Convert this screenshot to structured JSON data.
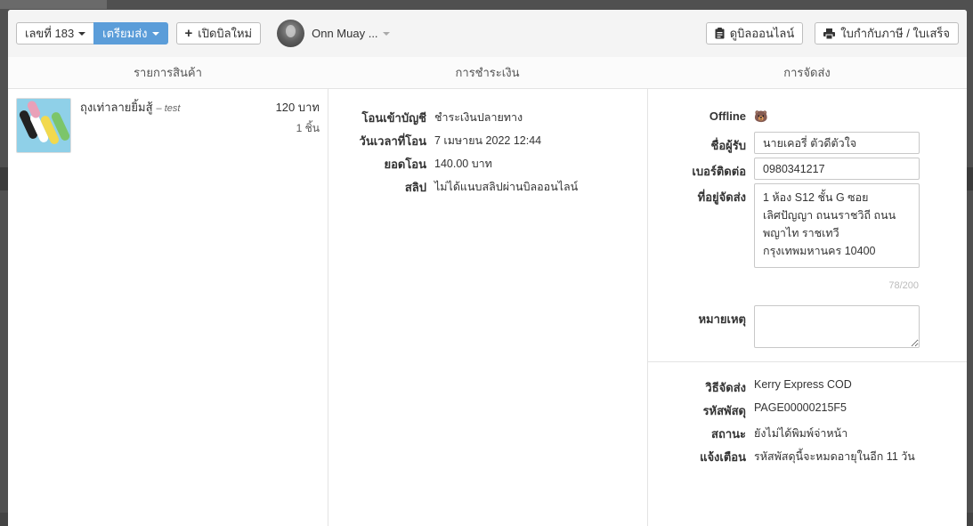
{
  "header": {
    "bill_number_label": "เลขที่ 183",
    "status_label": "เตรียมส่ง",
    "new_bill_label": "เปิดบิลใหม่",
    "user_name": "Onn Muay ...",
    "view_online_label": "ดูบิลออนไลน์",
    "receipt_label": "ใบกำกับภาษี / ใบเสร็จ"
  },
  "columns": {
    "products": "รายการสินค้า",
    "payment": "การชำระเงิน",
    "shipping": "การจัดส่ง"
  },
  "products": [
    {
      "name": "ถุงเท่าลายยิ้มสู้",
      "note": "– test",
      "price": "120 บาท",
      "qty": "1 ชิ้น"
    }
  ],
  "payment": {
    "rows": [
      {
        "label": "โอนเข้าบัญชี",
        "value": "ชำระเงินปลายทาง"
      },
      {
        "label": "วันเวลาที่โอน",
        "value": "7 เมษายน 2022 12:44"
      },
      {
        "label": "ยอดโอน",
        "value": "140.00 บาท"
      },
      {
        "label": "สลิป",
        "value": "ไม่ได้แนบสลิปผ่านบิลออนไลน์"
      }
    ]
  },
  "shipping": {
    "status_label": "Offline",
    "status_icon": "bear-icon",
    "recipient_label": "ชื่อผู้รับ",
    "recipient_value": "นายเคอรี่ ตัวดีตัวใจ",
    "phone_label": "เบอร์ติดต่อ",
    "phone_value": "0980341217",
    "address_label": "ที่อยู่จัดส่ง",
    "address_value": "1 ห้อง S12 ชั้น G ซอยเลิศปัญญา ถนนราชวิถี ถนนพญาไท ราชเทวี กรุงเทพมหานคร 10400",
    "address_counter": "78/200",
    "note_label": "หมายเหตุ",
    "note_value": "",
    "details": [
      {
        "label": "วิธีจัดส่ง",
        "value": "Kerry Express COD"
      },
      {
        "label": "รหัสพัสดุ",
        "value": "PAGE00000215F5"
      },
      {
        "label": "สถานะ",
        "value": "ยังไม่ได้พิมพ์จ่าหน้า"
      },
      {
        "label": "แจ้งเตือน",
        "value": "รหัสพัสดุนี้จะหมดอายุในอีก 11 วัน"
      }
    ]
  }
}
